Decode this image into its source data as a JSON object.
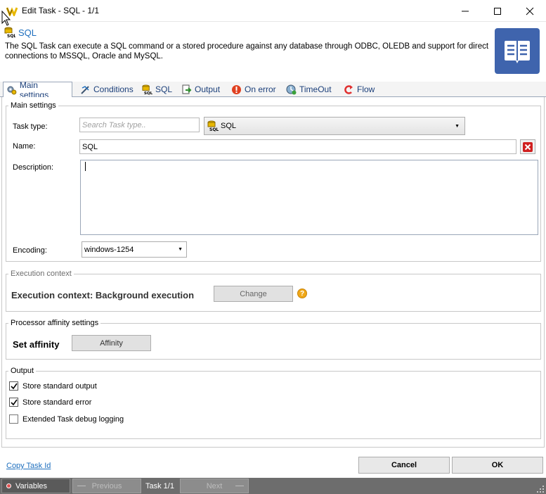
{
  "window": {
    "title": "Edit Task - SQL - 1/1",
    "minimize_glyph": "—",
    "maximize_glyph": "☐",
    "close_glyph": "✕"
  },
  "header": {
    "title": "SQL",
    "description": "The SQL Task can execute a SQL command or a stored procedure against any database through ODBC, OLEDB and support for direct connections to MSSQL, Oracle and MySQL."
  },
  "tabs": [
    {
      "label": "Main settings",
      "icon": "gear-icon"
    },
    {
      "label": "Conditions",
      "icon": "conditions-icon"
    },
    {
      "label": "SQL",
      "icon": "sql-icon"
    },
    {
      "label": "Output",
      "icon": "output-icon"
    },
    {
      "label": "On error",
      "icon": "error-icon"
    },
    {
      "label": "TimeOut",
      "icon": "timeout-icon"
    },
    {
      "label": "Flow",
      "icon": "flow-icon"
    }
  ],
  "main_settings": {
    "legend": "Main settings",
    "task_type_label": "Task type:",
    "search_placeholder": "Search Task type..",
    "task_type_value": "SQL",
    "name_label": "Name:",
    "name_value": "SQL",
    "description_label": "Description:",
    "description_value": "",
    "encoding_label": "Encoding:",
    "encoding_value": "windows-1254"
  },
  "execution_context": {
    "legend": "Execution context",
    "text": "Execution context: Background execution",
    "change_button": "Change",
    "help_glyph": "?"
  },
  "processor_affinity": {
    "legend": "Processor affinity settings",
    "label": "Set affinity",
    "button": "Affinity"
  },
  "output": {
    "legend": "Output",
    "options": [
      {
        "label": "Store standard output",
        "checked": true
      },
      {
        "label": "Store standard error",
        "checked": true
      },
      {
        "label": "Extended Task debug logging",
        "checked": false
      }
    ]
  },
  "footer": {
    "copy_task_id": "Copy Task Id",
    "cancel": "Cancel",
    "ok": "OK"
  },
  "statusbar": {
    "variables": "Variables",
    "previous": "Previous",
    "task_counter": "Task 1/1",
    "next": "Next"
  },
  "colors": {
    "accent_blue": "#1e6fbe",
    "book_icon_bg": "#3f64ad",
    "statusbar_bg": "#6d6d6d",
    "help_icon": "#f0a818"
  }
}
